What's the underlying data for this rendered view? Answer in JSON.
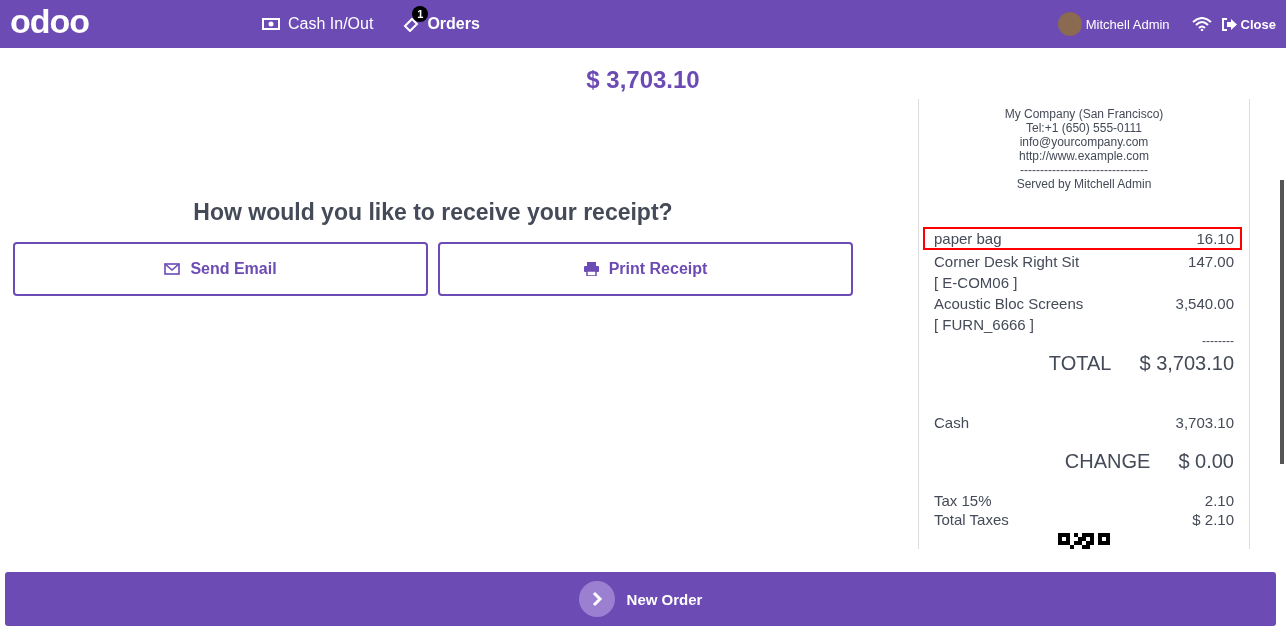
{
  "header": {
    "logo": "odoo",
    "nav": [
      {
        "label": "Cash In/Out",
        "kind": "cash",
        "active": false
      },
      {
        "label": "Orders",
        "kind": "orders",
        "badge": "1",
        "active": true
      }
    ],
    "user": "Mitchell Admin",
    "close": "Close"
  },
  "total": "$ 3,703.10",
  "question": "How would you like to receive your receipt?",
  "actions": [
    {
      "label": "Send Email",
      "kind": "email"
    },
    {
      "label": "Print Receipt",
      "kind": "print"
    }
  ],
  "receipt": {
    "header_lines": [
      "My Company (San Francisco)",
      "Tel:+1 (650) 555-0111",
      "info@yourcompany.com",
      "http://www.example.com",
      "--------------------------------",
      "Served by Mitchell Admin"
    ],
    "lines": [
      {
        "name": "paper bag",
        "amount": "16.10",
        "highlighted": true
      },
      {
        "name": "Corner Desk Right Sit",
        "amount": "147.00",
        "code": "[ E-COM06 ]",
        "highlighted": false
      },
      {
        "name": "Acoustic Bloc Screens",
        "amount": "3,540.00",
        "code": "[ FURN_6666 ]",
        "highlighted": false
      }
    ],
    "separator": "--------",
    "total_label": "TOTAL",
    "total_value": "$ 3,703.10",
    "payment_label": "Cash",
    "payment_value": "3,703.10",
    "change_label": "CHANGE",
    "change_value": "$ 0.00",
    "taxes": [
      {
        "label": "Tax 15%",
        "value": "2.10"
      },
      {
        "label": "Total Taxes",
        "value": "$ 2.10"
      }
    ]
  },
  "new_order": "New Order"
}
